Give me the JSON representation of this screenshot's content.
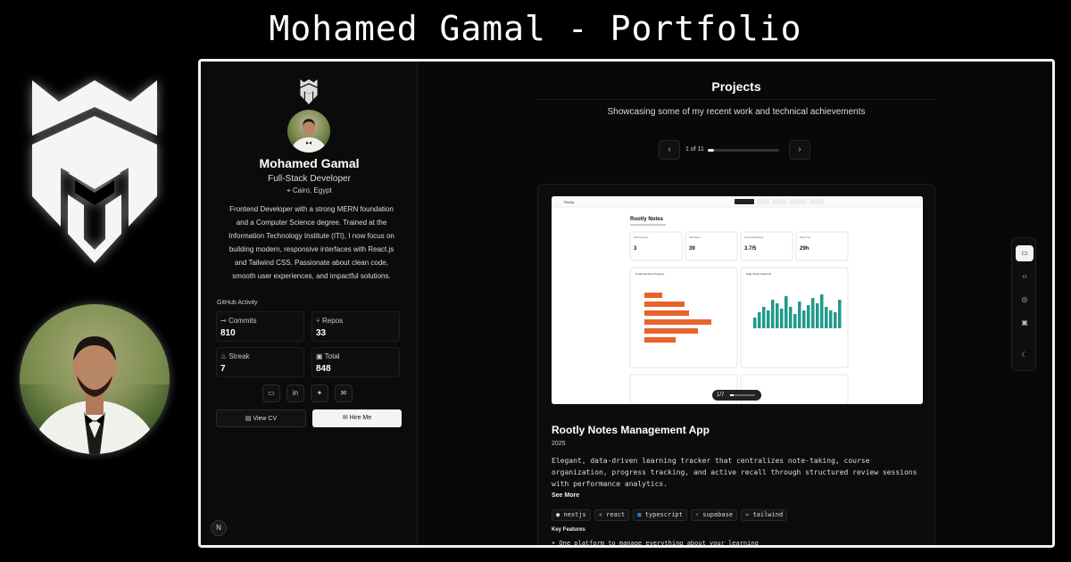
{
  "banner": {
    "title": "Mohamed Gamal - Portfolio"
  },
  "sidebar": {
    "name": "Mohamed Gamal",
    "role": "Full-Stack Developer",
    "location": "Cairo, Egypt",
    "bio": "Frontend Developer with a strong MERN foundation and a Computer Science degree. Trained at the Information Technology Institute (ITI), I now focus on building modern, responsive interfaces with React.js and Tailwind CSS. Passionate about clean code, smooth user experiences, and impactful solutions.",
    "github_title": "GitHub Activity",
    "stats": [
      {
        "label": "Commits",
        "value": "810",
        "icon": "commit-icon"
      },
      {
        "label": "Repos",
        "value": "33",
        "icon": "branch-icon"
      },
      {
        "label": "Streak",
        "value": "7",
        "icon": "flame-icon"
      },
      {
        "label": "Total",
        "value": "848",
        "icon": "calendar-icon"
      }
    ],
    "socials": [
      "portfolio-icon",
      "linkedin-icon",
      "twitter-icon",
      "mail-icon"
    ],
    "view_cv": "View CV",
    "hire_me": "Hire Me",
    "badge": "N"
  },
  "projects": {
    "title": "Projects",
    "subtitle": "Showcasing some of my recent work and technical achievements",
    "pager": {
      "text": "1 of 11",
      "progress": 0.09
    },
    "card": {
      "image_counter": "1/7",
      "image_progress": 0.14,
      "name": "Rootly Notes Management App",
      "year": "2025",
      "description": "Elegant, data-driven learning tracker that centralizes note-taking, course organization, progress tracking, and active recall through structured review sessions with performance analytics.",
      "see_more": "See More",
      "tags": [
        "nextjs",
        "react",
        "typescript",
        "supabase",
        "tailwind"
      ],
      "key_features_title": "Key Features",
      "key_feature_1": "• One platform to manage everything about your learning"
    },
    "screenshot": {
      "app_title": "Rootly Notes",
      "app_name": "Rootly",
      "metrics": [
        {
          "label": "Total Overview",
          "value": "3"
        },
        {
          "label": "Total Notes",
          "value": "39"
        },
        {
          "label": "Avg Understanding",
          "value": "3.7/5"
        },
        {
          "label": "Study Time",
          "value": "29h"
        }
      ],
      "panel_left": "Understanding Progress",
      "panel_right": "Daily Study Sessions",
      "bars_h": [
        0.2,
        0.45,
        0.5,
        0.75,
        0.6,
        0.35
      ],
      "bars_v": [
        0.3,
        0.45,
        0.6,
        0.5,
        0.8,
        0.7,
        0.55,
        0.9,
        0.6,
        0.4,
        0.75,
        0.5,
        0.65,
        0.85,
        0.7,
        0.95,
        0.6,
        0.5,
        0.45,
        0.8
      ],
      "accent_orange": "#e8642c",
      "accent_teal": "#1f9a8a"
    },
    "dock": [
      "folder-icon",
      "code-icon",
      "award-icon",
      "briefcase-icon",
      "moon-icon"
    ]
  }
}
